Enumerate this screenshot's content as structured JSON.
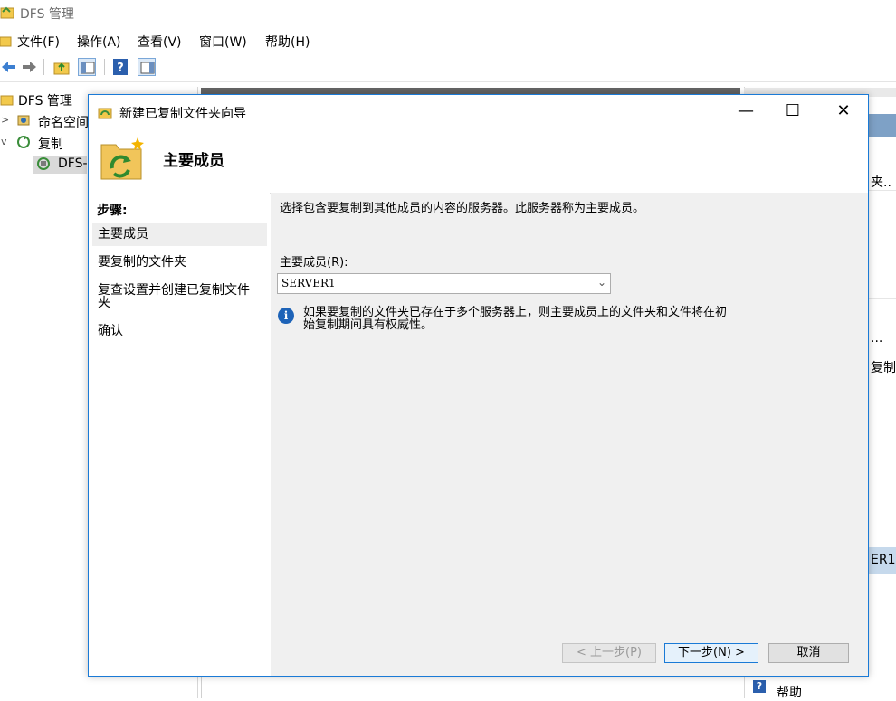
{
  "app": {
    "title": "DFS 管理",
    "menu": [
      "文件(F)",
      "操作(A)",
      "查看(V)",
      "窗口(W)",
      "帮助(H)"
    ],
    "tree": {
      "root": "DFS 管理",
      "namespaces": "命名空间",
      "replication": "复制",
      "group": "DFS-"
    },
    "right_fragments": [
      "夹..",
      "...",
      "复制",
      "ER1"
    ],
    "help_label": "帮助"
  },
  "wizard": {
    "title": "新建已复制文件夹向导",
    "header_title": "主要成员",
    "steps_heading": "步骤:",
    "steps": [
      "主要成员",
      "要复制的文件夹",
      "复查设置并创建已复制文件夹",
      "确认"
    ],
    "description": "选择包含要复制到其他成员的内容的服务器。此服务器称为主要成员。",
    "primary_member_label": "主要成员(R):",
    "primary_member_value": "SERVER1",
    "info_text": "如果要复制的文件夹已存在于多个服务器上，则主要成员上的文件夹和文件将在初始复制期间具有权威性。",
    "buttons": {
      "back": "< 上一步(P)",
      "next": "下一步(N) >",
      "cancel": "取消"
    },
    "window_controls": {
      "minimize": "—",
      "maximize": "☐",
      "close": "✕"
    }
  }
}
